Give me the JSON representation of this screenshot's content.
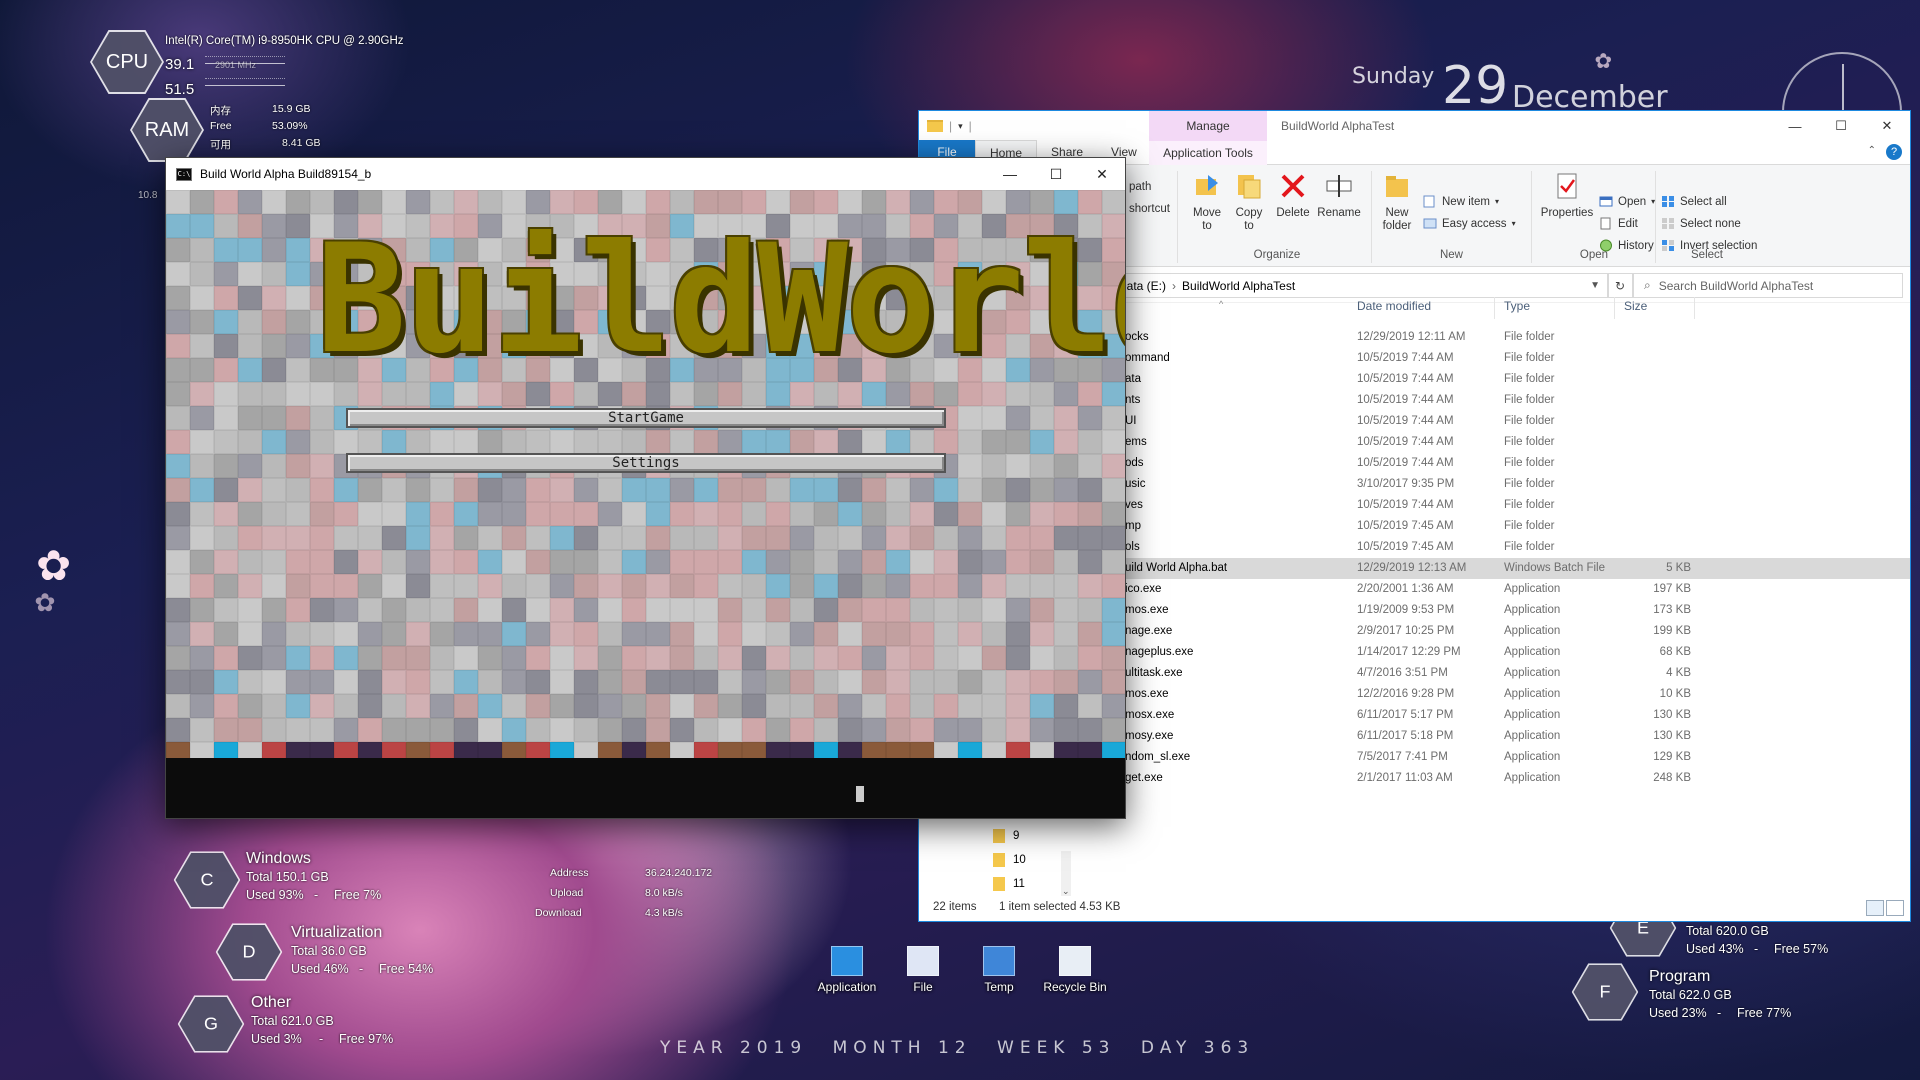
{
  "sysmon": {
    "cpu_label": "CPU",
    "cpu_name": "Intel(R) Core(TM) i9-8950HK CPU @ 2.90GHz",
    "cpu_v1": "39.1",
    "cpu_v2": "51.5",
    "cpu_mhz": "2901 MHz",
    "side_val": "10.8",
    "ram_label": "RAM",
    "ram_rows": [
      {
        "label": "内存",
        "value": "15.9 GB"
      },
      {
        "label": "Free",
        "value": "53.09%"
      },
      {
        "label": "可用",
        "value": "8.41 GB"
      }
    ]
  },
  "clock": {
    "weekday": "Sunday",
    "day": "29",
    "month": "December"
  },
  "date_strip": [
    "YEAR  2019",
    "MONTH  12",
    "WEEK  53",
    "DAY  363"
  ],
  "network": {
    "address_label": "Address",
    "address_value": "36.24.240.172",
    "upload_label": "Upload",
    "upload_value": "8.0 kB/s",
    "download_label": "Download",
    "download_value": "4.3 kB/s"
  },
  "drives_left": [
    {
      "letter": "C",
      "name": "Windows",
      "total": "Total 150.1 GB",
      "used": "Used 93%",
      "free": "Free 7%"
    },
    {
      "letter": "D",
      "name": "Virtualization",
      "total": "Total 36.0 GB",
      "used": "Used 46%",
      "free": "Free 54%"
    },
    {
      "letter": "G",
      "name": "Other",
      "total": "Total 621.0 GB",
      "used": "Used 3%",
      "free": "Free 97%"
    }
  ],
  "drives_right": [
    {
      "letter": "E",
      "name": "",
      "total": "Total 620.0 GB",
      "used": "Used 43%",
      "free": "Free 57%"
    },
    {
      "letter": "F",
      "name": "Program",
      "total": "Total 622.0 GB",
      "used": "Used 23%",
      "free": "Free 77%"
    }
  ],
  "desktop_icons": [
    {
      "label": "Application",
      "color": "#2a8fe0"
    },
    {
      "label": "File",
      "color": "#dfe6f5"
    },
    {
      "label": "Temp",
      "color": "#3f86d8"
    },
    {
      "label": "Recycle Bin",
      "color": "#e8eef5"
    }
  ],
  "game": {
    "title": "Build World Alpha Build89154_b",
    "logo": "BuildWorld",
    "start_label": "StartGame",
    "settings_label": "Settings",
    "minimize": "—",
    "maximize": "☐",
    "close": "✕"
  },
  "explorer": {
    "manage_label": "Manage",
    "title": "BuildWorld AlphaTest",
    "tabs": [
      "File",
      "Home",
      "Share",
      "View"
    ],
    "app_tools_label": "Application Tools",
    "ribbon": {
      "clipboard_partial": [
        "path",
        "shortcut"
      ],
      "move_to": "Move to",
      "copy_to": "Copy to",
      "delete": "Delete",
      "rename": "Rename",
      "new_folder": "New folder",
      "new_item": "New item",
      "easy_access": "Easy access",
      "properties": "Properties",
      "open": "Open",
      "edit": "Edit",
      "history": "History",
      "select_all": "Select all",
      "select_none": "Select none",
      "invert_selection": "Invert selection",
      "groups": {
        "organize": "Organize",
        "new": "New",
        "open": "Open",
        "select": "Select"
      }
    },
    "address": {
      "drive": "Data (E:)",
      "separator": "›",
      "folder": "BuildWorld AlphaTest"
    },
    "search_placeholder": "Search BuildWorld AlphaTest",
    "columns": {
      "date": "Date modified",
      "type": "Type",
      "size": "Size"
    },
    "files": [
      {
        "name": "ocks",
        "date": "12/29/2019 12:11 AM",
        "type": "File folder",
        "size": ""
      },
      {
        "name": "ommand",
        "date": "10/5/2019 7:44 AM",
        "type": "File folder",
        "size": ""
      },
      {
        "name": "ata",
        "date": "10/5/2019 7:44 AM",
        "type": "File folder",
        "size": ""
      },
      {
        "name": "nts",
        "date": "10/5/2019 7:44 AM",
        "type": "File folder",
        "size": ""
      },
      {
        "name": "UI",
        "date": "10/5/2019 7:44 AM",
        "type": "File folder",
        "size": ""
      },
      {
        "name": "ems",
        "date": "10/5/2019 7:44 AM",
        "type": "File folder",
        "size": ""
      },
      {
        "name": "ods",
        "date": "10/5/2019 7:44 AM",
        "type": "File folder",
        "size": ""
      },
      {
        "name": "usic",
        "date": "3/10/2017 9:35 PM",
        "type": "File folder",
        "size": ""
      },
      {
        "name": "ves",
        "date": "10/5/2019 7:44 AM",
        "type": "File folder",
        "size": ""
      },
      {
        "name": "mp",
        "date": "10/5/2019 7:45 AM",
        "type": "File folder",
        "size": ""
      },
      {
        "name": "ols",
        "date": "10/5/2019 7:45 AM",
        "type": "File folder",
        "size": ""
      },
      {
        "name": "uild World Alpha.bat",
        "date": "12/29/2019 12:13 AM",
        "type": "Windows Batch File",
        "size": "5 KB",
        "selected": true
      },
      {
        "name": "ico.exe",
        "date": "2/20/2001 1:36 AM",
        "type": "Application",
        "size": "197 KB"
      },
      {
        "name": "mos.exe",
        "date": "1/19/2009 9:53 PM",
        "type": "Application",
        "size": "173 KB"
      },
      {
        "name": "nage.exe",
        "date": "2/9/2017 10:25 PM",
        "type": "Application",
        "size": "199 KB"
      },
      {
        "name": "nageplus.exe",
        "date": "1/14/2017 12:29 PM",
        "type": "Application",
        "size": "68 KB"
      },
      {
        "name": "ultitask.exe",
        "date": "4/7/2016 3:51 PM",
        "type": "Application",
        "size": "4 KB"
      },
      {
        "name": "mos.exe",
        "date": "12/2/2016 9:28 PM",
        "type": "Application",
        "size": "10 KB"
      },
      {
        "name": "mosx.exe",
        "date": "6/11/2017 5:17 PM",
        "type": "Application",
        "size": "130 KB"
      },
      {
        "name": "mosy.exe",
        "date": "6/11/2017 5:18 PM",
        "type": "Application",
        "size": "130 KB"
      },
      {
        "name": "ndom_sl.exe",
        "date": "7/5/2017 7:41 PM",
        "type": "Application",
        "size": "129 KB"
      },
      {
        "name": "get.exe",
        "date": "2/1/2017 11:03 AM",
        "type": "Application",
        "size": "248 KB"
      }
    ],
    "nav_items": [
      "9",
      "10",
      "11"
    ],
    "status": {
      "count": "22 items",
      "selected": "1 item selected  4.53 KB"
    }
  }
}
